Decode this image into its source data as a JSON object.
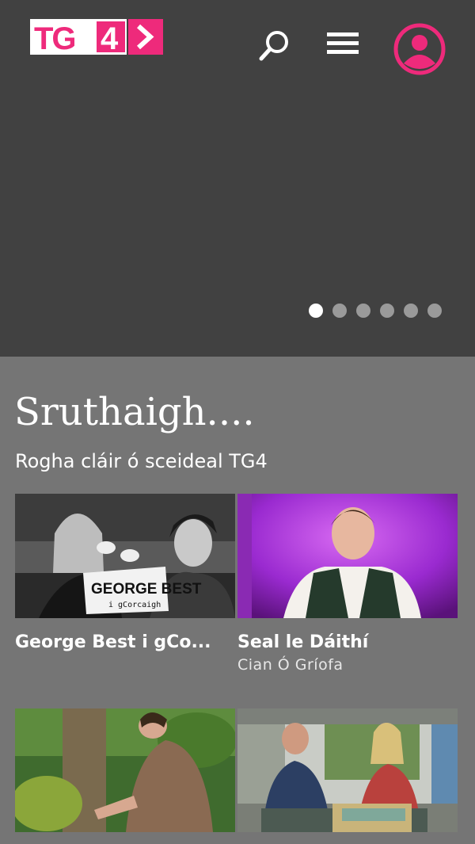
{
  "header": {
    "logo_text": "TG4",
    "icons": [
      "search-icon",
      "menu-icon",
      "account-icon"
    ],
    "accent_color": "#ee2a7b"
  },
  "carousel": {
    "slide_count": 6,
    "active_index": 0
  },
  "section": {
    "title": "Sruthaigh....",
    "subtitle": "Rogha cláir ó sceideal TG4"
  },
  "cards": [
    {
      "title": "George Best i gCo...",
      "subtitle": "",
      "thumb_caption": "GEORGE BEST",
      "thumb_caption2": "i gCorcaigh"
    },
    {
      "title": "Seal le Dáithí",
      "subtitle": "Cian Ó Gríofa"
    },
    {
      "title": "",
      "subtitle": ""
    },
    {
      "title": "",
      "subtitle": ""
    }
  ]
}
